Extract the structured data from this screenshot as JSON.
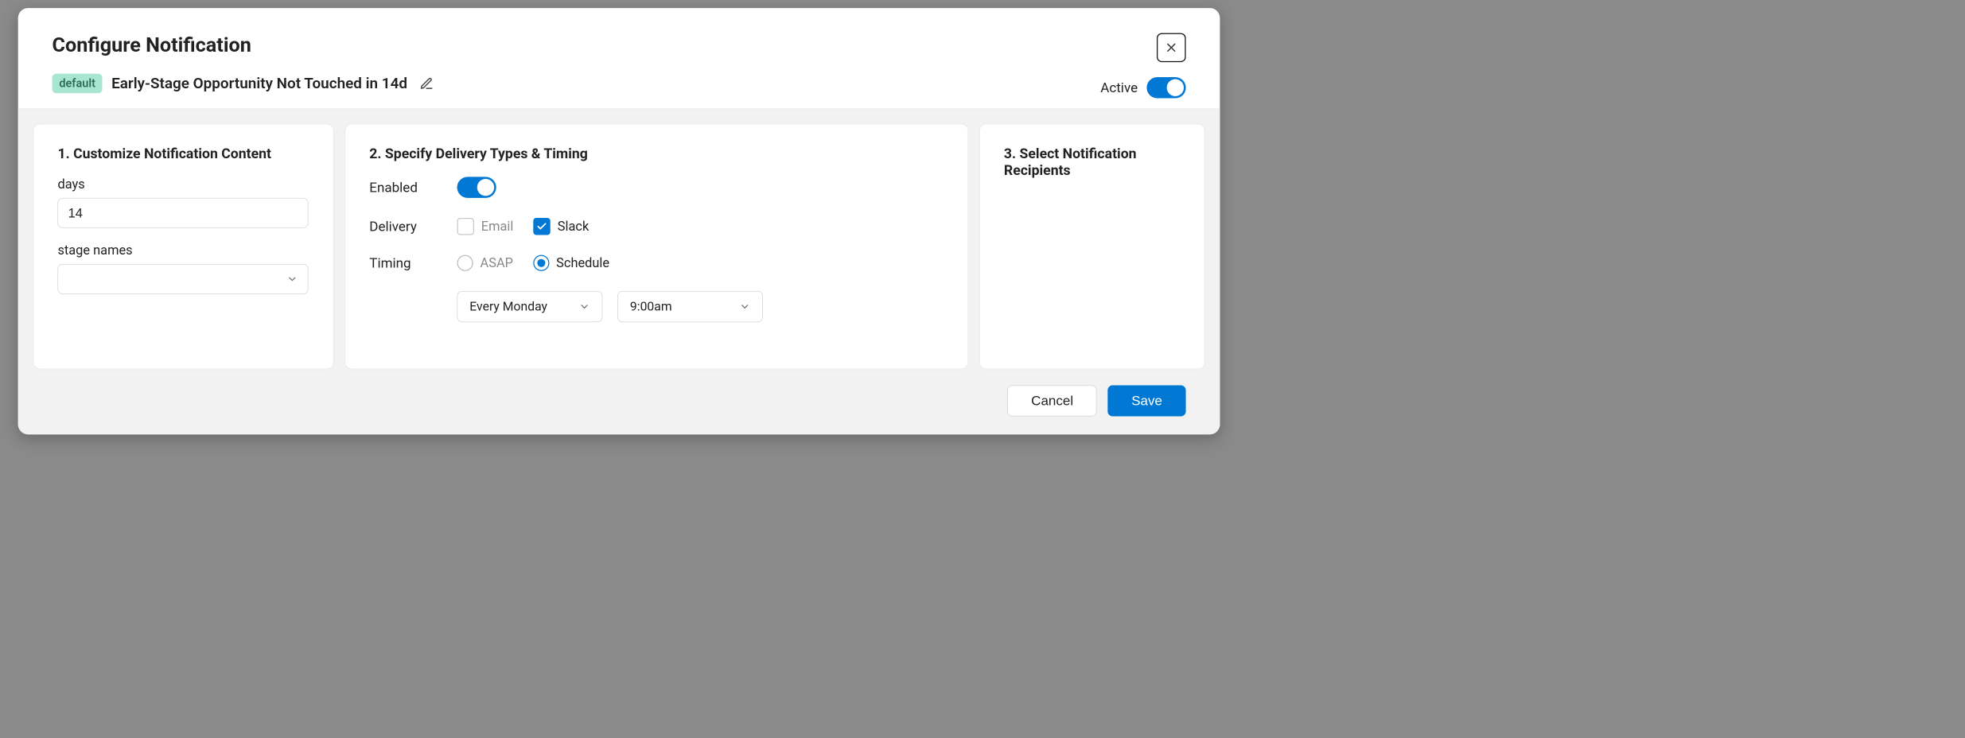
{
  "header": {
    "title": "Configure Notification",
    "badge": "default",
    "notification_name": "Early-Stage Opportunity Not Touched in 14d",
    "active_label": "Active",
    "active_on": true
  },
  "panel1": {
    "heading": "1. Customize Notification Content",
    "days_label": "days",
    "days_value": "14",
    "stagenames_label": "stage names",
    "stagenames_value": ""
  },
  "panel2": {
    "heading": "2. Specify Delivery Types & Timing",
    "enabled_label": "Enabled",
    "enabled_on": true,
    "delivery_label": "Delivery",
    "email_label": "Email",
    "email_checked": false,
    "slack_label": "Slack",
    "slack_checked": true,
    "timing_label": "Timing",
    "asap_label": "ASAP",
    "schedule_label": "Schedule",
    "timing_selected": "schedule",
    "schedule_day": "Every Monday",
    "schedule_time": "9:00am"
  },
  "panel3": {
    "heading": "3. Select Notification Recipients"
  },
  "footer": {
    "cancel_label": "Cancel",
    "save_label": "Save"
  }
}
